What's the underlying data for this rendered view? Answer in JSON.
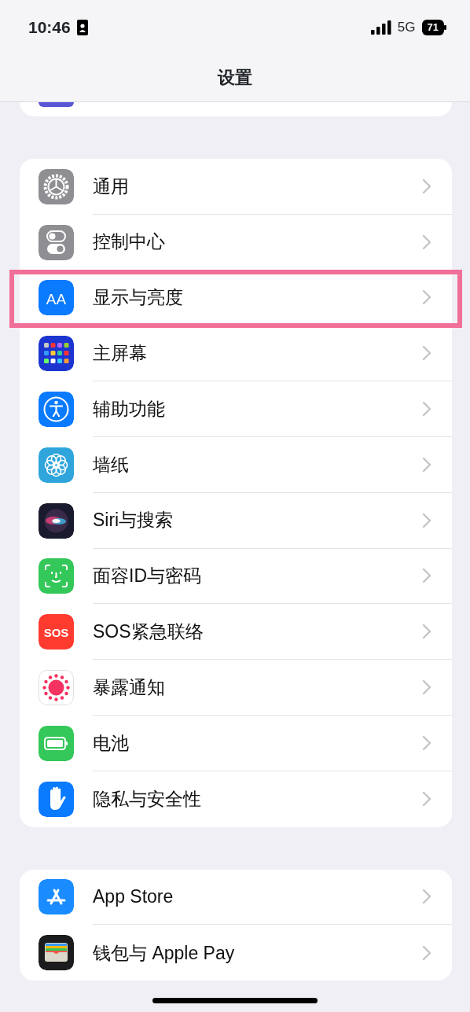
{
  "status_bar": {
    "time": "10:46",
    "network": "5G",
    "battery": "71"
  },
  "title": "设置",
  "groups": [
    {
      "items": [
        {
          "label": "通用",
          "highlighted": false
        },
        {
          "label": "控制中心",
          "highlighted": false
        },
        {
          "label": "显示与亮度",
          "highlighted": true,
          "icon_label": "AA"
        },
        {
          "label": "主屏幕",
          "highlighted": false
        },
        {
          "label": "辅助功能",
          "highlighted": false
        },
        {
          "label": "墙纸",
          "highlighted": false
        },
        {
          "label": "Siri与搜索",
          "highlighted": false
        },
        {
          "label": "面容ID与密码",
          "highlighted": false
        },
        {
          "label": "SOS紧急联络",
          "highlighted": false,
          "icon_label": "SOS"
        },
        {
          "label": "暴露通知",
          "highlighted": false
        },
        {
          "label": "电池",
          "highlighted": false
        },
        {
          "label": "隐私与安全性",
          "highlighted": false
        }
      ]
    },
    {
      "items": [
        {
          "label": "App Store",
          "highlighted": false
        },
        {
          "label": "钱包与 Apple Pay",
          "highlighted": false
        }
      ]
    }
  ]
}
